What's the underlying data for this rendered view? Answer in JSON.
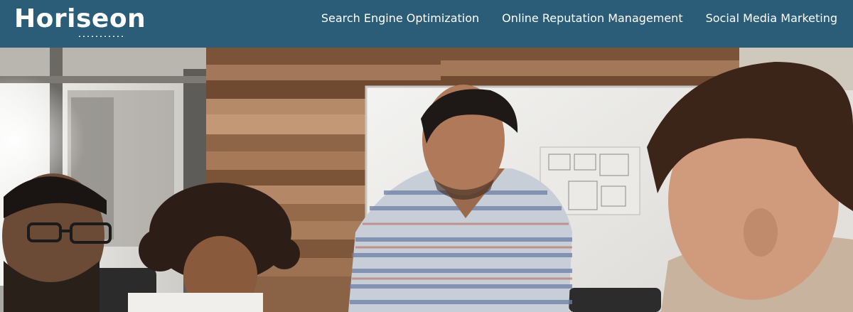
{
  "header": {
    "logo_text_part1": "Hori",
    "logo_text_part2": "seo",
    "logo_text_part3": "n",
    "nav": [
      {
        "label": "Search Engine Optimization"
      },
      {
        "label": "Online Reputation Management"
      },
      {
        "label": "Social Media Marketing"
      }
    ],
    "background_color": "#2b5d78"
  },
  "hero": {
    "image_description_icon": "team-meeting-photo"
  }
}
